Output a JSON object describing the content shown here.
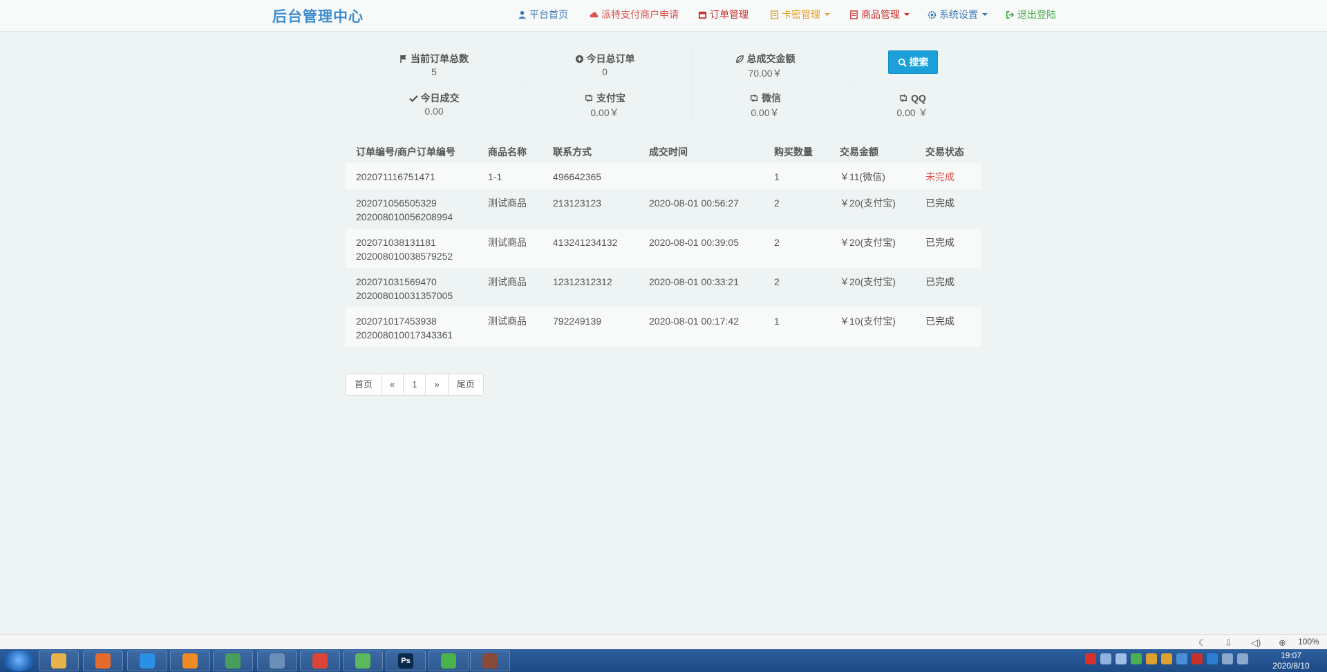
{
  "nav": {
    "brand": "后台管理中心",
    "items": [
      {
        "label": "平台首页",
        "icon": "user-icon",
        "color": "#3c7ab8"
      },
      {
        "label": "派特支付商户申请",
        "icon": "cloud-icon",
        "color": "#d9534f"
      },
      {
        "label": "订单管理",
        "icon": "calendar-icon",
        "color": "#c9302c"
      },
      {
        "label": "卡密管理",
        "icon": "card-icon",
        "color": "#e0a030"
      },
      {
        "label": "商品管理",
        "icon": "list-icon",
        "color": "#c9302c"
      },
      {
        "label": "系统设置",
        "icon": "gear-icon",
        "color": "#3c7ab8"
      },
      {
        "label": "退出登陆",
        "icon": "logout-icon",
        "color": "#4cae4c"
      }
    ]
  },
  "stats": {
    "total_orders": {
      "label": "当前订单总数",
      "value": "5"
    },
    "today_orders": {
      "label": "今日总订单",
      "value": "0"
    },
    "total_amount": {
      "label": "总成交金额",
      "value": "70.00￥"
    },
    "search_label": "搜索",
    "today_deal": {
      "label": "今日成交",
      "value": "0.00"
    },
    "alipay": {
      "label": "支付宝",
      "value": "0.00￥"
    },
    "wechat": {
      "label": "微信",
      "value": "0.00￥"
    },
    "qq": {
      "label": "QQ",
      "value": "0.00 ￥"
    }
  },
  "table": {
    "headers": [
      "订单编号/商户订单编号",
      "商品名称",
      "联系方式",
      "成交时间",
      "购买数量",
      "交易金额",
      "交易状态"
    ],
    "rows": [
      {
        "order_no": "202071116751471",
        "merchant_no": "",
        "product": "1-1",
        "contact": "496642365",
        "time": "",
        "qty": "1",
        "amount": "￥11(微信)",
        "status": "未完成"
      },
      {
        "order_no": "202071056505329",
        "merchant_no": "202008010056208994",
        "product": "测试商品",
        "contact": "213123123",
        "time": "2020-08-01 00:56:27",
        "qty": "2",
        "amount": "￥20(支付宝)",
        "status": "已完成"
      },
      {
        "order_no": "202071038131181",
        "merchant_no": "202008010038579252",
        "product": "测试商品",
        "contact": "413241234132",
        "time": "2020-08-01 00:39:05",
        "qty": "2",
        "amount": "￥20(支付宝)",
        "status": "已完成"
      },
      {
        "order_no": "202071031569470",
        "merchant_no": "202008010031357005",
        "product": "测试商品",
        "contact": "12312312312",
        "time": "2020-08-01 00:33:21",
        "qty": "2",
        "amount": "￥20(支付宝)",
        "status": "已完成"
      },
      {
        "order_no": "202071017453938",
        "merchant_no": "202008010017343361",
        "product": "测试商品",
        "contact": "792249139",
        "time": "2020-08-01 00:17:42",
        "qty": "1",
        "amount": "￥10(支付宝)",
        "status": "已完成"
      }
    ]
  },
  "pagination": {
    "first": "首页",
    "prev": "«",
    "current": "1",
    "next": "»",
    "last": "尾页"
  },
  "browser_status": {
    "zoom": "100%"
  },
  "taskbar": {
    "apps": [
      {
        "name": "explorer-app",
        "glyph": "",
        "color": "#e8b34a"
      },
      {
        "name": "firefox-app",
        "glyph": "",
        "color": "#e66a2c"
      },
      {
        "name": "baidu-netdisk-app",
        "glyph": "",
        "color": "#2c8fe6"
      },
      {
        "name": "uc-browser-app",
        "glyph": "",
        "color": "#f08a24"
      },
      {
        "name": "chrome-app-1",
        "glyph": "",
        "color": "#4a9e5c"
      },
      {
        "name": "network-app",
        "glyph": "",
        "color": "#6c8fb8"
      },
      {
        "name": "chrome-app-2",
        "glyph": "",
        "color": "#db4437"
      },
      {
        "name": "media-player-app",
        "glyph": "",
        "color": "#5cb85c"
      },
      {
        "name": "photoshop-app",
        "glyph": "Ps",
        "color": "#0b2a4a"
      },
      {
        "name": "wechat-app",
        "glyph": "",
        "color": "#49b24a"
      },
      {
        "name": "avatar-app",
        "glyph": "",
        "color": "#8a4a3a"
      }
    ],
    "time": "19:07",
    "date": "2020/8/10"
  }
}
